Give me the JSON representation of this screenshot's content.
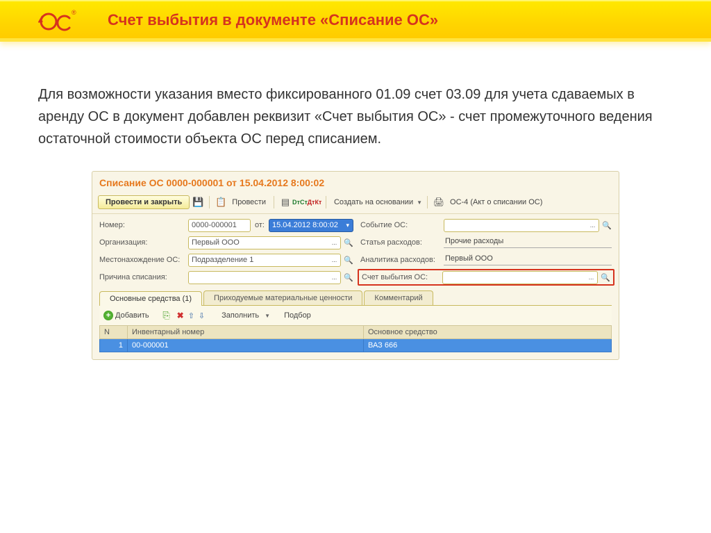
{
  "slide": {
    "title": "Счет выбытия в документе «Списание ОС»",
    "body": "Для возможности указания вместо фиксированного 01.09 счет 03.09 для учета сдаваемых в аренду ОС в документ добавлен реквизит «Счет выбытия ОС» - счет промежуточного ведения остаточной стоимости объекта ОС перед списанием."
  },
  "doc": {
    "title": "Списание ОС 0000-000001 от 15.04.2012 8:00:02",
    "toolbar": {
      "post_close": "Провести и закрыть",
      "post": "Провести",
      "create_based": "Создать на основании",
      "print_item": "ОС-4 (Акт о списании ОС)"
    },
    "fields": {
      "number_label": "Номер:",
      "number": "0000-000001",
      "from_label": "от:",
      "date": "15.04.2012  8:00:02",
      "event_label": "Событие ОС:",
      "event": "",
      "org_label": "Организация:",
      "org": "Первый ООО",
      "expense_label": "Статья расходов:",
      "expense": "Прочие расходы",
      "loc_label": "Местонахождение ОС:",
      "loc": "Подразделение 1",
      "analytics_label": "Аналитика расходов:",
      "analytics": "Первый ООО",
      "reason_label": "Причина списания:",
      "reason": "",
      "disposal_label": "Счет выбытия ОС:",
      "disposal": ""
    },
    "tabs": {
      "t1": "Основные средства (1)",
      "t2": "Приходуемые материальные ценности",
      "t3": "Комментарий"
    },
    "tab_toolbar": {
      "add": "Добавить",
      "fill": "Заполнить",
      "pick": "Подбор"
    },
    "table": {
      "col_n": "N",
      "col_inv": "Инвентарный номер",
      "col_os": "Основное средство",
      "row1_n": "1",
      "row1_inv": "00-000001",
      "row1_os": "ВАЗ 666"
    }
  }
}
